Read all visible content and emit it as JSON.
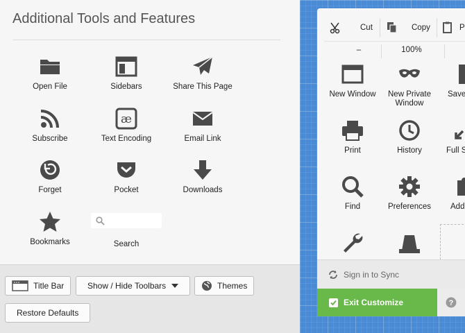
{
  "palette": {
    "title": "Additional Tools and Features",
    "tools": [
      {
        "label": "Open File",
        "icon": "folder-icon"
      },
      {
        "label": "Sidebars",
        "icon": "sidebar-icon"
      },
      {
        "label": "Share This Page",
        "icon": "paper-plane-icon"
      },
      {
        "label": "Subscribe",
        "icon": "rss-icon"
      },
      {
        "label": "Text Encoding",
        "icon": "text-encoding-icon"
      },
      {
        "label": "Email Link",
        "icon": "envelope-icon"
      },
      {
        "label": "Forget",
        "icon": "forget-icon"
      },
      {
        "label": "Pocket",
        "icon": "pocket-icon"
      },
      {
        "label": "Downloads",
        "icon": "download-arrow-icon"
      },
      {
        "label": "Bookmarks",
        "icon": "star-icon"
      }
    ],
    "search": {
      "label": "Search",
      "placeholder": "",
      "value": ""
    }
  },
  "footer": {
    "title_bar": "Title Bar",
    "show_hide_toolbars": "Show / Hide Toolbars",
    "themes": "Themes",
    "restore_defaults": "Restore Defaults"
  },
  "panel": {
    "edit": {
      "cut": "Cut",
      "copy": "Copy",
      "paste": "P"
    },
    "zoom": {
      "minus": "–",
      "level": "100%",
      "plus": "+"
    },
    "items": [
      {
        "label": "New Window",
        "icon": "window-icon"
      },
      {
        "label": "New Private Window",
        "icon": "mask-icon"
      },
      {
        "label": "Save",
        "icon": "save-icon"
      },
      {
        "label": "Print",
        "icon": "printer-icon"
      },
      {
        "label": "History",
        "icon": "clock-icon"
      },
      {
        "label": "Full S",
        "icon": "fullscreen-icon"
      },
      {
        "label": "Find",
        "icon": "magnifier-icon"
      },
      {
        "label": "Preferences",
        "icon": "gear-icon"
      },
      {
        "label": "Add",
        "icon": "puzzle-icon"
      },
      {
        "label": "",
        "icon": "wrench-icon"
      },
      {
        "label": "",
        "icon": "hat-icon"
      }
    ],
    "sync": "Sign in to Sync",
    "exit": "Exit Customize"
  },
  "colors": {
    "accent_green": "#68b84a",
    "blueprint": "#4a8bd6",
    "icon": "#4a4a4a"
  }
}
